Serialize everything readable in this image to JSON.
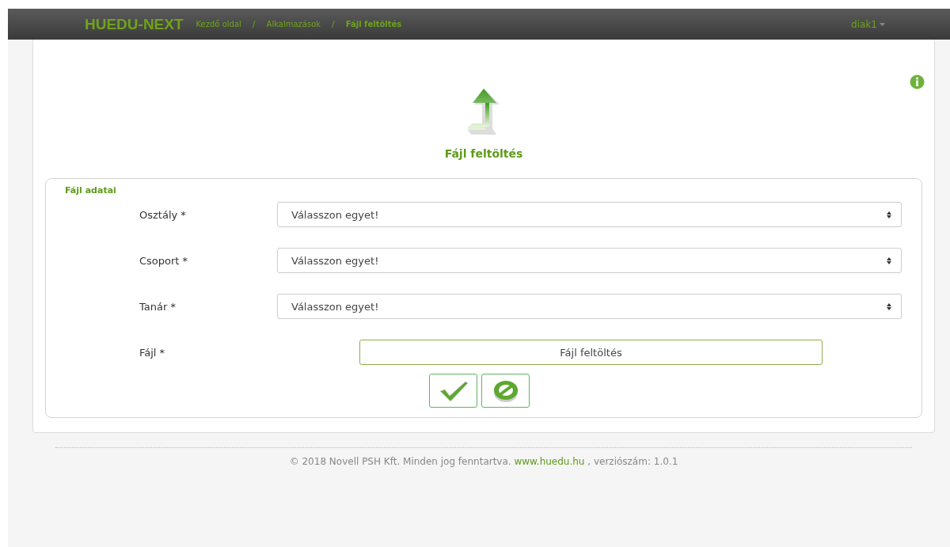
{
  "navbar": {
    "brand": "HUEDU-NEXT",
    "breadcrumb": [
      {
        "label": "Kezdő oldal",
        "selected": false
      },
      {
        "label": "Alkalmazások",
        "selected": false
      },
      {
        "label": "Fájl feltöltés",
        "selected": true
      }
    ],
    "separator": "/",
    "user": "diak1"
  },
  "page": {
    "title": "Fájl feltöltés"
  },
  "form": {
    "legend": "Fájl adatai",
    "fields": [
      {
        "kind": "select",
        "label": "Osztály *",
        "value": "Válasszon egyet!"
      },
      {
        "kind": "select",
        "label": "Csoport *",
        "value": "Válasszon egyet!"
      },
      {
        "kind": "select",
        "label": "Tanár *",
        "value": "Válasszon egyet!"
      },
      {
        "kind": "file",
        "label": "Fájl *",
        "button": "Fájl feltöltés"
      }
    ]
  },
  "footer": {
    "text": "© 2018 Novell PSH Kft. Minden jog fenntartva.",
    "link": "www.huedu.hu",
    "suffix": ", verziószám: 1.0.1"
  }
}
